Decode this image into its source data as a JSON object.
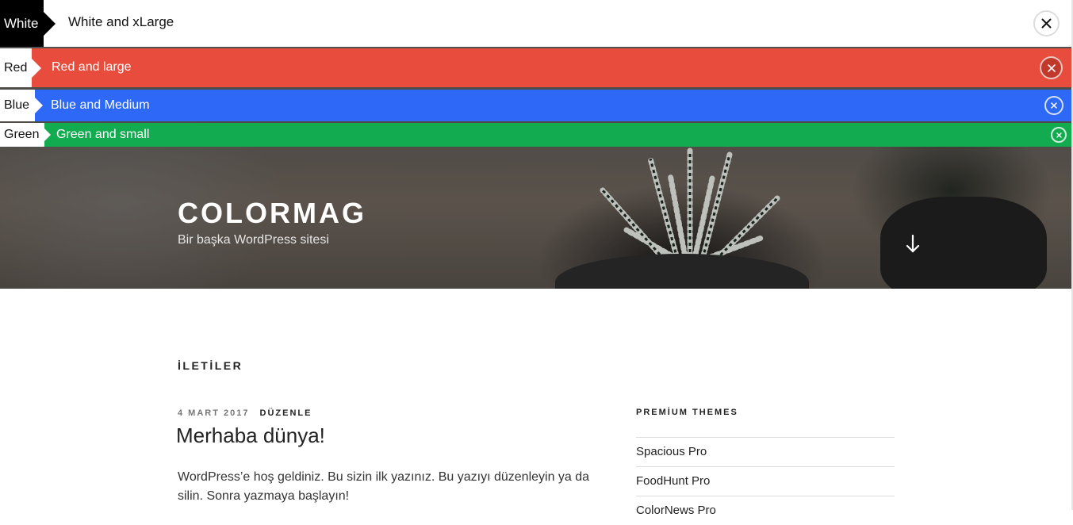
{
  "notifications": [
    {
      "tag": "White",
      "message": "White and xLarge"
    },
    {
      "tag": "Red",
      "message": "Red and large"
    },
    {
      "tag": "Blue",
      "message": "Blue and Medium"
    },
    {
      "tag": "Green",
      "message": "Green and small"
    }
  ],
  "header": {
    "site_title": "COLORMAG",
    "site_description": "Bir başka WordPress sitesi"
  },
  "main": {
    "section_title": "İLETİLER",
    "post": {
      "date": "4 MART 2017",
      "edit_label": "DÜZENLE",
      "title": "Merhaba dünya!",
      "excerpt": "WordPress’e hoş geldiniz. Bu sizin ilk yazınız. Bu yazıyı düzenleyin ya da silin. Sonra yazmaya başlayın!"
    }
  },
  "sidebar": {
    "widget_title": "PREMİUM THEMES",
    "items": [
      "Spacious Pro",
      "FoodHunt Pro",
      "ColorNews Pro"
    ]
  },
  "colors": {
    "red": "#e74c3c",
    "blue": "#2d69f6",
    "green": "#13ab4f",
    "white_tag": "#000000"
  },
  "icons": {
    "close": "close-icon",
    "scroll": "arrow-down-icon"
  }
}
